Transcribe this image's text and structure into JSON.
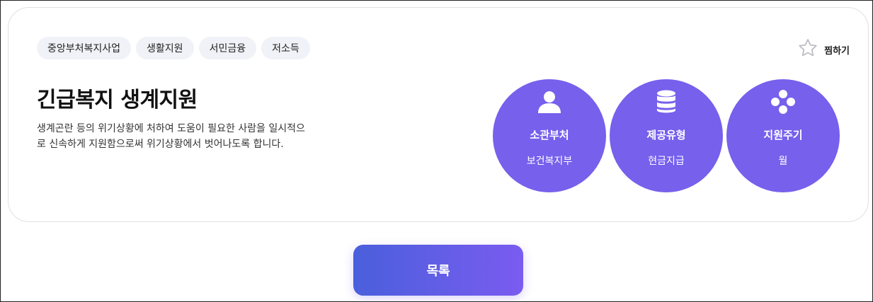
{
  "tags": [
    "중앙부처복지사업",
    "생활지원",
    "서민금융",
    "저소득"
  ],
  "favorite": {
    "label": "찜하기",
    "icon": "star-outline-icon"
  },
  "title": "긴급복지 생계지원",
  "description": "생계곤란 등의 위기상황에 처하여 도움이 필요한 사람을 일시적으로 신속하게 지원함으로써 위기상황에서 벗어나도록 합니다.",
  "info": [
    {
      "label": "소관부처",
      "value": "보건복지부",
      "icon": "person-icon"
    },
    {
      "label": "제공유형",
      "value": "현금지급",
      "icon": "database-icon"
    },
    {
      "label": "지원주기",
      "value": "월",
      "icon": "cycle-dots-icon"
    }
  ],
  "list_button": {
    "label": "목록"
  },
  "colors": {
    "accent": "#7660ec",
    "tag_bg": "#f1f2f7",
    "button_start": "#4a5fdc",
    "button_end": "#7a5cf0"
  }
}
